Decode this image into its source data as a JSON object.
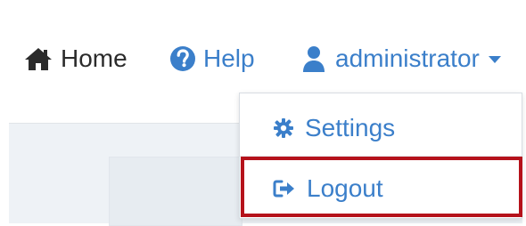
{
  "nav": {
    "home_label": "Home",
    "help_label": "Help",
    "user_label": "administrator"
  },
  "dropdown": {
    "items": [
      {
        "label": "Settings",
        "icon": "gear-icon"
      },
      {
        "label": "Logout",
        "icon": "sign-out-icon"
      }
    ]
  },
  "colors": {
    "link": "#3b7fca",
    "text_dark": "#2b2b2b",
    "highlight": "#b5121b",
    "content_bg": "#eef2f6"
  }
}
